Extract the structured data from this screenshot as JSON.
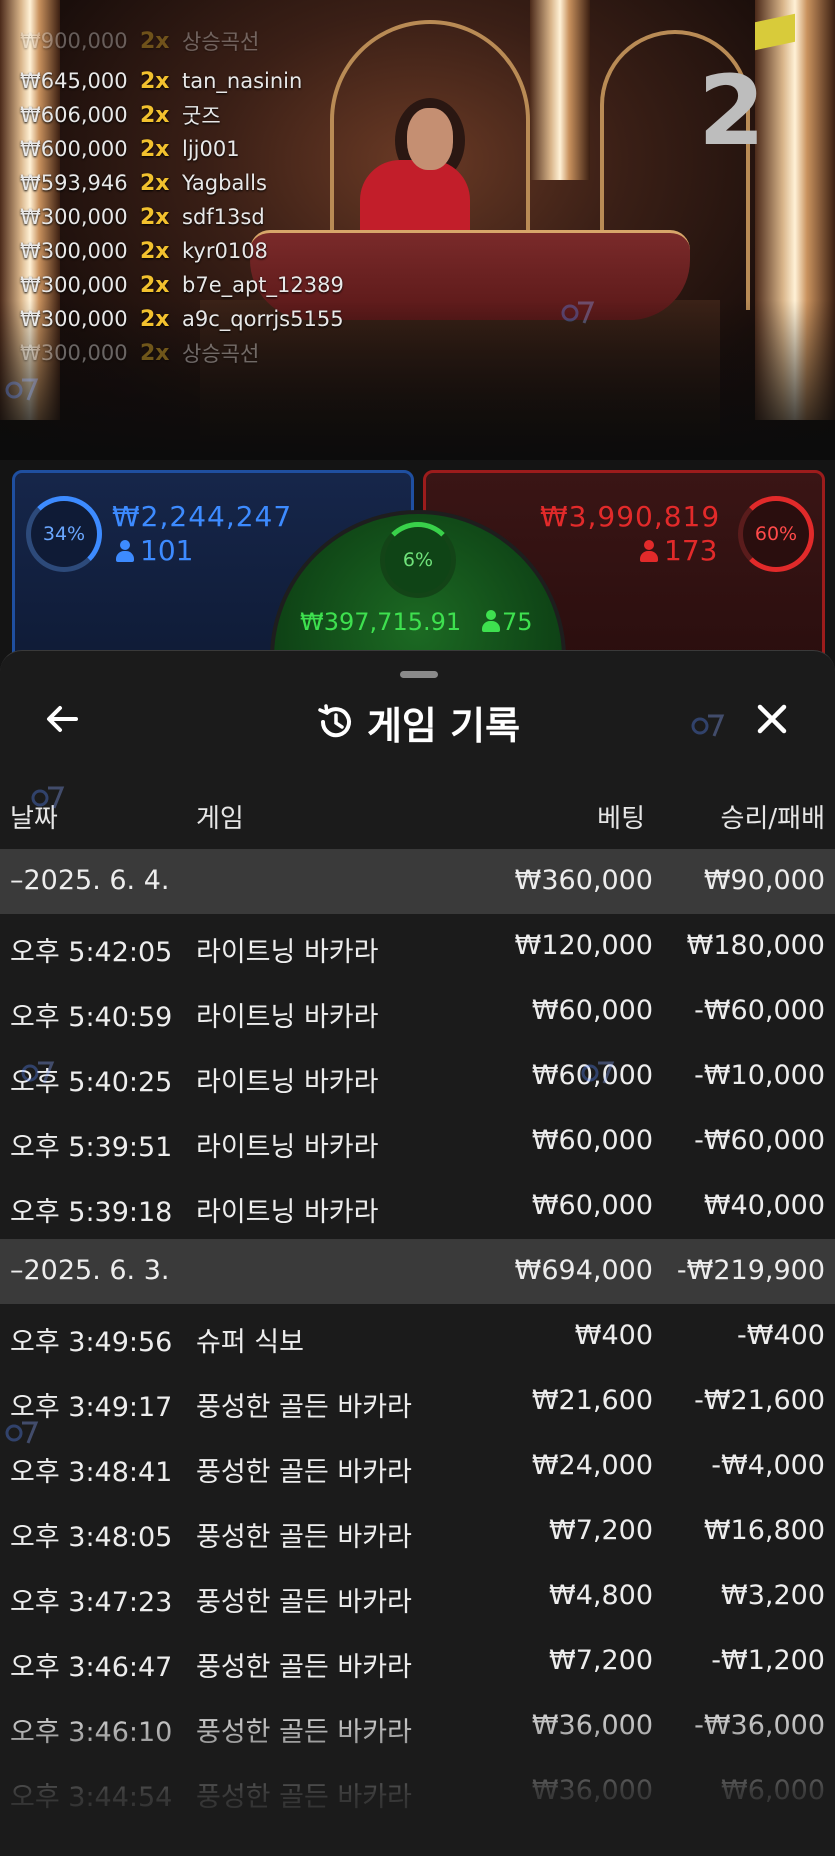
{
  "leaderboard": [
    {
      "amount": "₩645,000",
      "mult": "2x",
      "name": "tan_nasinin"
    },
    {
      "amount": "₩606,000",
      "mult": "2x",
      "name": "굿즈"
    },
    {
      "amount": "₩600,000",
      "mult": "2x",
      "name": "ljj001"
    },
    {
      "amount": "₩593,946",
      "mult": "2x",
      "name": "Yagballs"
    },
    {
      "amount": "₩300,000",
      "mult": "2x",
      "name": "sdf13sd"
    },
    {
      "amount": "₩300,000",
      "mult": "2x",
      "name": "kyr0108"
    },
    {
      "amount": "₩300,000",
      "mult": "2x",
      "name": "b7e_apt_12389"
    },
    {
      "amount": "₩300,000",
      "mult": "2x",
      "name": "a9c_qorrjs5155"
    },
    {
      "amount": "₩300,000",
      "mult": "2x",
      "name": "상승곡선"
    }
  ],
  "round_number": "2",
  "bets": {
    "player": {
      "percent": "34%",
      "amount": "₩2,244,247",
      "count": "101",
      "color": "#3d8bff"
    },
    "banker": {
      "percent": "60%",
      "amount": "₩3,990,819",
      "count": "173",
      "color": "#e22a2a"
    },
    "tie": {
      "percent": "6%",
      "amount": "₩397,715.91",
      "count": "75",
      "color": "#3ee04f"
    }
  },
  "sheet": {
    "title": "게임 기록",
    "columns": {
      "date": "날짜",
      "game": "게임",
      "bet": "베팅",
      "winloss": "승리/패배"
    },
    "rows": [
      {
        "type": "date",
        "time": "–2025. 6. 4.",
        "game": "",
        "bet": "₩360,000",
        "wl": "₩90,000"
      },
      {
        "type": "item",
        "time": "오후 5:42:05",
        "game": "라이트닝 바카라",
        "bet": "₩120,000",
        "wl": "₩180,000"
      },
      {
        "type": "item",
        "time": "오후 5:40:59",
        "game": "라이트닝 바카라",
        "bet": "₩60,000",
        "wl": "-₩60,000"
      },
      {
        "type": "item",
        "time": "오후 5:40:25",
        "game": "라이트닝 바카라",
        "bet": "₩60,000",
        "wl": "-₩10,000"
      },
      {
        "type": "item",
        "time": "오후 5:39:51",
        "game": "라이트닝 바카라",
        "bet": "₩60,000",
        "wl": "-₩60,000"
      },
      {
        "type": "item",
        "time": "오후 5:39:18",
        "game": "라이트닝 바카라",
        "bet": "₩60,000",
        "wl": "₩40,000"
      },
      {
        "type": "date",
        "time": "–2025. 6. 3.",
        "game": "",
        "bet": "₩694,000",
        "wl": "-₩219,900"
      },
      {
        "type": "item",
        "time": "오후 3:49:56",
        "game": "슈퍼 식보",
        "bet": "₩400",
        "wl": "-₩400"
      },
      {
        "type": "item",
        "time": "오후 3:49:17",
        "game": "풍성한 골든 바카라",
        "bet": "₩21,600",
        "wl": "-₩21,600"
      },
      {
        "type": "item",
        "time": "오후 3:48:41",
        "game": "풍성한 골든 바카라",
        "bet": "₩24,000",
        "wl": "-₩4,000"
      },
      {
        "type": "item",
        "time": "오후 3:48:05",
        "game": "풍성한 골든 바카라",
        "bet": "₩7,200",
        "wl": "₩16,800"
      },
      {
        "type": "item",
        "time": "오후 3:47:23",
        "game": "풍성한 골든 바카라",
        "bet": "₩4,800",
        "wl": "₩3,200"
      },
      {
        "type": "item",
        "time": "오후 3:46:47",
        "game": "풍성한 골든 바카라",
        "bet": "₩7,200",
        "wl": "-₩1,200"
      },
      {
        "type": "item",
        "time": "오후 3:46:10",
        "game": "풍성한 골든 바카라",
        "bet": "₩36,000",
        "wl": "-₩36,000"
      },
      {
        "type": "item",
        "time": "오후 3:44:54",
        "game": "풍성한 골든 바카라",
        "bet": "₩36,000",
        "wl": "₩6,000"
      }
    ]
  }
}
